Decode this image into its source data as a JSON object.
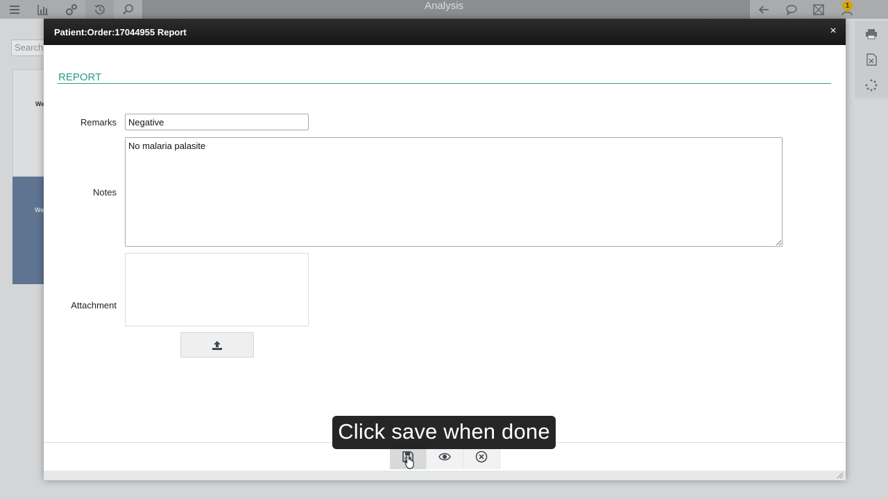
{
  "app": {
    "title": "Analysis",
    "notification_count": "1",
    "search_placeholder": "Search"
  },
  "background": {
    "card_text": "We",
    "card2_text": "We"
  },
  "toolbar_left": [
    {
      "name": "menu-icon"
    },
    {
      "name": "bar-chart-icon"
    },
    {
      "name": "settings-icon"
    },
    {
      "name": "history-icon"
    },
    {
      "name": "search-icon"
    }
  ],
  "toolbar_right": [
    {
      "name": "back-arrow-icon"
    },
    {
      "name": "chat-icon"
    },
    {
      "name": "mail-icon"
    },
    {
      "name": "user-icon"
    }
  ],
  "side_tools": [
    {
      "name": "print-icon"
    },
    {
      "name": "excel-export-icon"
    },
    {
      "name": "loading-spinner-icon"
    }
  ],
  "modal": {
    "title": "Patient:Order:17044955 Report",
    "close_label": "×",
    "section_title": "REPORT",
    "fields": {
      "remarks_label": "Remarks",
      "remarks_value": "Negative",
      "notes_label": "Notes",
      "notes_value": "No malaria palasite",
      "attachment_label": "Attachment"
    },
    "footer_buttons": [
      {
        "name": "save-icon"
      },
      {
        "name": "preview-eye-icon"
      },
      {
        "name": "cancel-circle-icon"
      }
    ]
  },
  "tooltip": {
    "text": "Click save when done"
  },
  "colors": {
    "accent": "#2a9b84",
    "header_bg": "#1f1f1f",
    "badge": "#d8a400"
  }
}
